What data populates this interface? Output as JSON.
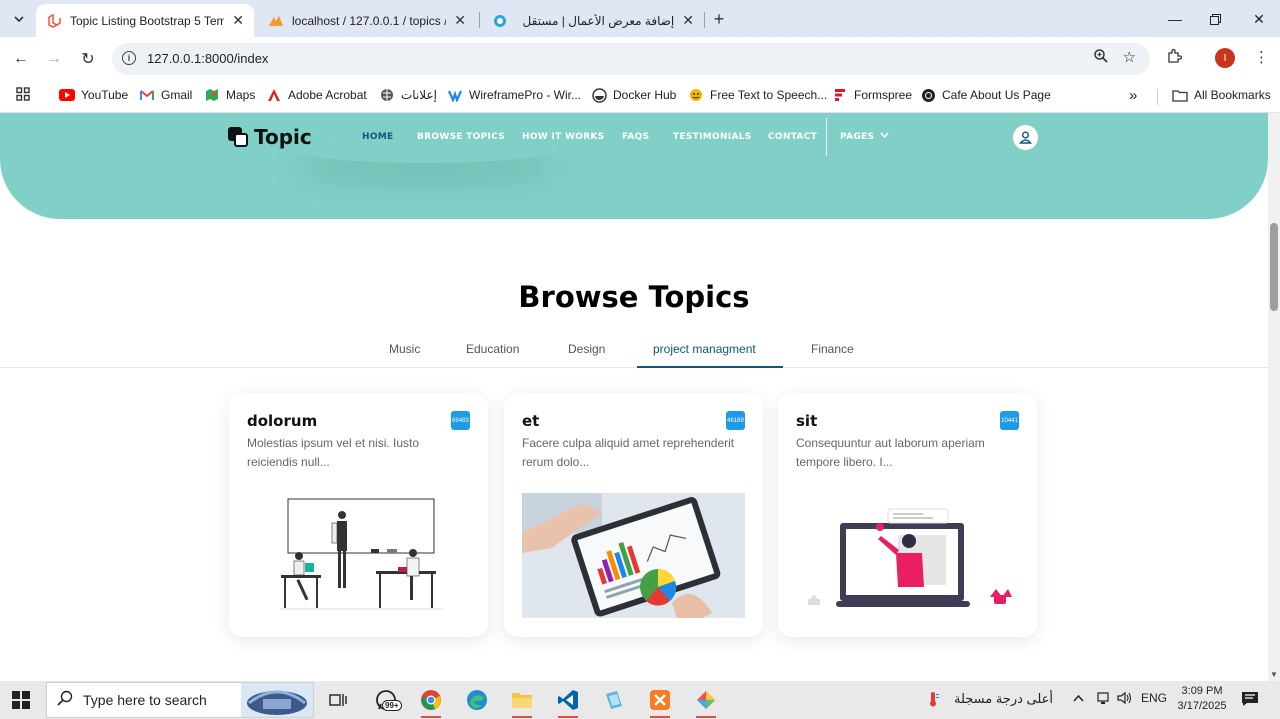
{
  "browser": {
    "tabs": [
      {
        "title": "Topic Listing Bootstrap 5 Templ",
        "icon": "laravel-icon",
        "active": true
      },
      {
        "title": "localhost / 127.0.0.1 / topics / t",
        "icon": "phpmyadmin-icon",
        "active": false
      },
      {
        "title": "إضافة معرض الأعمال | مستقل",
        "icon": "mostaql-icon",
        "active": false
      }
    ],
    "url": "127.0.0.1:8000/index",
    "profile_initial": "I",
    "bookmarks": [
      {
        "label": "YouTube",
        "icon": "youtube-icon"
      },
      {
        "label": "Gmail",
        "icon": "gmail-icon"
      },
      {
        "label": "Maps",
        "icon": "maps-icon"
      },
      {
        "label": "Adobe Acrobat",
        "icon": "acrobat-icon"
      },
      {
        "label": "إعلانات",
        "icon": "globe-icon"
      },
      {
        "label": "WireframePro - Wir...",
        "icon": "wireframepro-icon"
      },
      {
        "label": "Docker Hub",
        "icon": "docker-icon"
      },
      {
        "label": "Free Text to Speech...",
        "icon": "tts-icon"
      },
      {
        "label": "Formspree",
        "icon": "formspree-icon"
      },
      {
        "label": "Cafe About Us Page",
        "icon": "cafe-icon"
      }
    ],
    "all_bookmarks": "All Bookmarks"
  },
  "site": {
    "brand": "Topic",
    "nav": [
      "HOME",
      "BROWSE TOPICS",
      "HOW IT WORKS",
      "FAQS",
      "TESTIMONIALS",
      "CONTACT",
      "PAGES"
    ],
    "active_nav": "HOME"
  },
  "browse": {
    "title": "Browse Topics",
    "tabs": [
      "Music",
      "Education",
      "Design",
      "project managment",
      "Finance"
    ],
    "active_tab": "project managment",
    "cards": [
      {
        "title": "dolorum",
        "desc": "Molestias ipsum vel et nisi. Iusto reiciendis null...",
        "badge": "89483",
        "image": "classroom-illustration"
      },
      {
        "title": "et",
        "desc": "Facere culpa aliquid amet reprehenderit rerum dolo...",
        "badge": "46169",
        "image": "tablet-charts-photo"
      },
      {
        "title": "sit",
        "desc": "Consequuntur aut laborum aperiam tempore libero. I...",
        "badge": "10441",
        "image": "online-teacher-illustration"
      }
    ]
  },
  "taskbar": {
    "search_placeholder": "Type here to search",
    "whatsapp_badge": "99+",
    "weather": "أعلى درجة مسجلة",
    "lang": "ENG",
    "time": "3:09 PM",
    "date": "3/17/2025"
  },
  "colors": {
    "hero": "#80d0c7",
    "brand_dark": "#13547a",
    "badge": "#1e9be6"
  }
}
